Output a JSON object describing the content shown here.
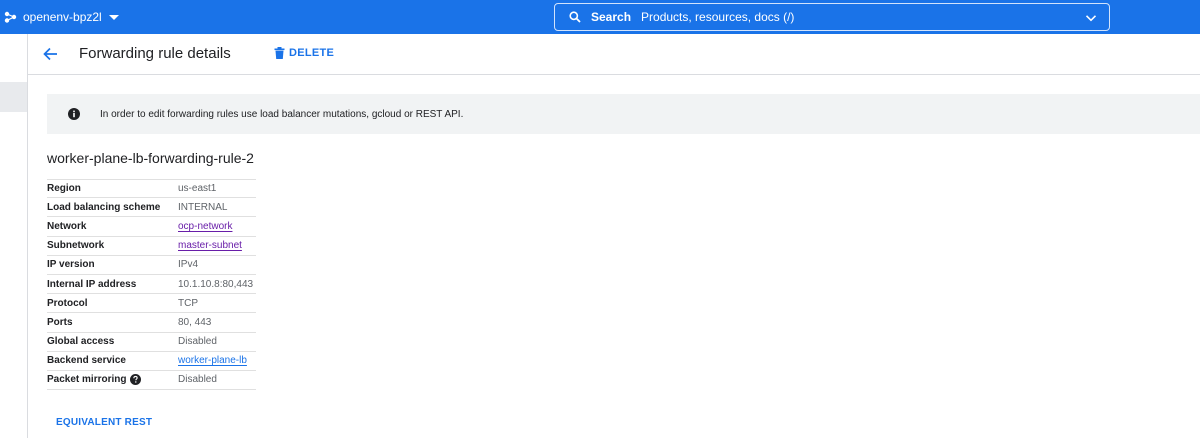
{
  "topbar": {
    "project_name": "openenv-bpz2l",
    "search_label": "Search",
    "search_placeholder": "Products, resources, docs (/)"
  },
  "header": {
    "title": "Forwarding rule details",
    "delete_label": "DELETE"
  },
  "banner": {
    "text": "In order to edit forwarding rules use load balancer mutations, gcloud or REST API."
  },
  "rule": {
    "name": "worker-plane-lb-forwarding-rule-2",
    "details": [
      {
        "key": "Region",
        "value": "us-east1"
      },
      {
        "key": "Load balancing scheme",
        "value": "INTERNAL"
      },
      {
        "key": "Network",
        "value": "ocp-network"
      },
      {
        "key": "Subnetwork",
        "value": "master-subnet"
      },
      {
        "key": "IP version",
        "value": "IPv4"
      },
      {
        "key": "Internal IP address",
        "value": "10.1.10.8:80,443"
      },
      {
        "key": "Protocol",
        "value": "TCP"
      },
      {
        "key": "Ports",
        "value": "80, 443"
      },
      {
        "key": "Global access",
        "value": "Disabled"
      },
      {
        "key": "Backend service",
        "value": "worker-plane-lb"
      },
      {
        "key": "Packet mirroring",
        "value": "Disabled"
      }
    ]
  },
  "footer": {
    "equivalent_rest_label": "EQUIVALENT REST"
  },
  "colors": {
    "topbar": "#1a73e8",
    "link": "#1a73e8",
    "visited_link": "#681da8",
    "banner_bg": "#f1f3f4"
  },
  "icons": [
    "project-icon",
    "search-icon",
    "chevron-down-icon",
    "back-arrow-icon",
    "trash-icon",
    "info-icon",
    "help-icon"
  ]
}
